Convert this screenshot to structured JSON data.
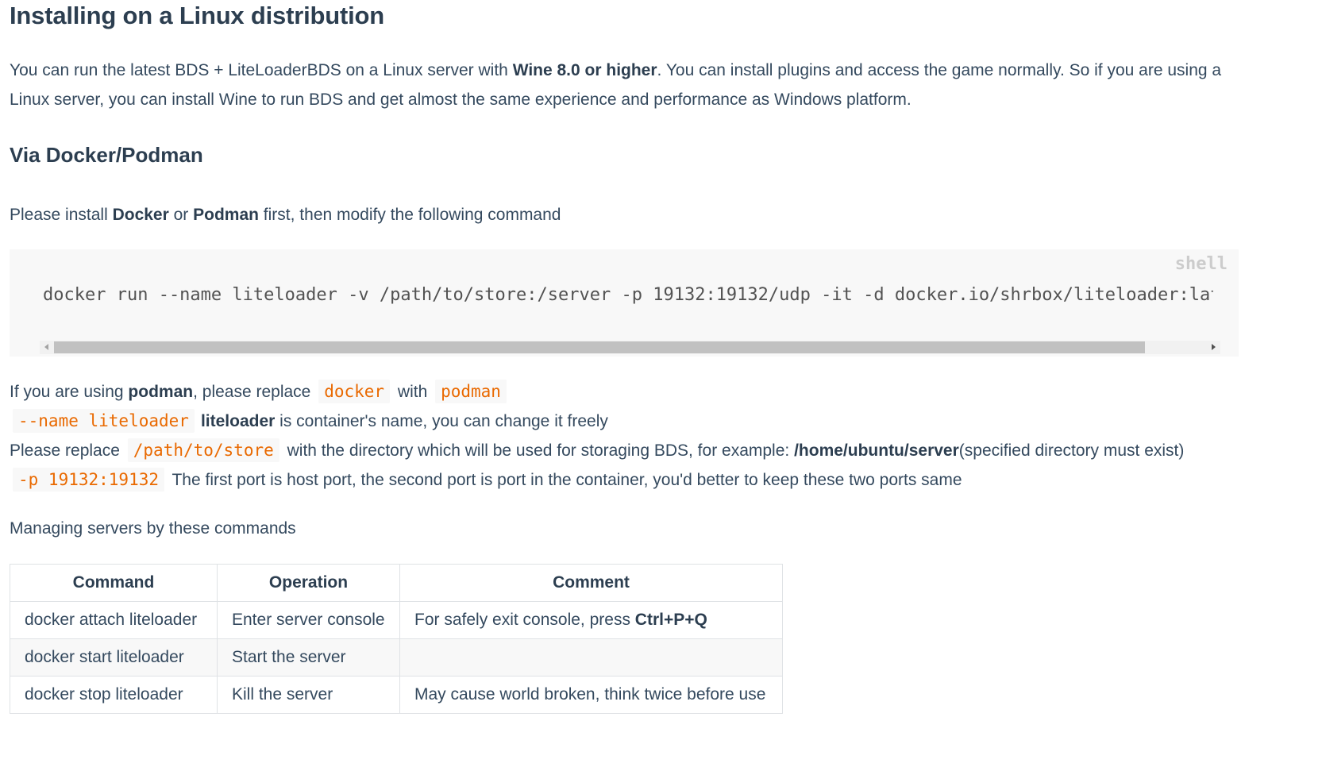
{
  "page": {
    "title": "Installing on a Linux distribution",
    "intro": {
      "part1": "You can run the latest BDS + LiteLoaderBDS on a Linux server with ",
      "bold": "Wine 8.0 or higher",
      "part2": ". You can install plugins and access the game normally. So if you are using a Linux server, you can install Wine to run BDS and get almost the same experience and performance as Windows platform."
    },
    "subtitle": "Via Docker/Podman",
    "install": {
      "part1": "Please install ",
      "docker": "Docker",
      "or": " or ",
      "podman": "Podman",
      "part2": " first, then modify the following command"
    }
  },
  "codeblock": {
    "lang": "shell",
    "command": "docker run --name liteloader -v /path/to/store:/server -p 19132:19132/udp -it -d docker.io/shrbox/liteloader:latest"
  },
  "notes": {
    "line1": {
      "t1": "If you are using ",
      "b1": "podman",
      "t2": ", please replace ",
      "c1": "docker",
      "t3": " with ",
      "c2": "podman"
    },
    "line2": {
      "c1": "--name liteloader",
      "b1": "liteloader",
      "t1": " is container's name, you can change it freely"
    },
    "line3": {
      "t1": "Please replace ",
      "c1": "/path/to/store",
      "t2": " with the directory which will be used for storaging BDS, for example: ",
      "b1": "/home/ubuntu/server",
      "t3": "(specified directory must exist)"
    },
    "line4": {
      "c1": "-p 19132:19132",
      "t1": " The first port is host port, the second port is port in the container, you'd better to keep these two ports same"
    }
  },
  "managing": "Managing servers by these commands",
  "table": {
    "headers": [
      "Command",
      "Operation",
      "Comment"
    ],
    "rows": [
      {
        "command": "docker attach liteloader",
        "operation": "Enter server console",
        "comment_text": "For safely exit console, press ",
        "comment_bold": "Ctrl+P+Q"
      },
      {
        "command": "docker start liteloader",
        "operation": "Start the server",
        "comment_text": "",
        "comment_bold": ""
      },
      {
        "command": "docker stop liteloader",
        "operation": "Kill the server",
        "comment_text": "May cause world broken, think twice before use",
        "comment_bold": ""
      }
    ]
  }
}
